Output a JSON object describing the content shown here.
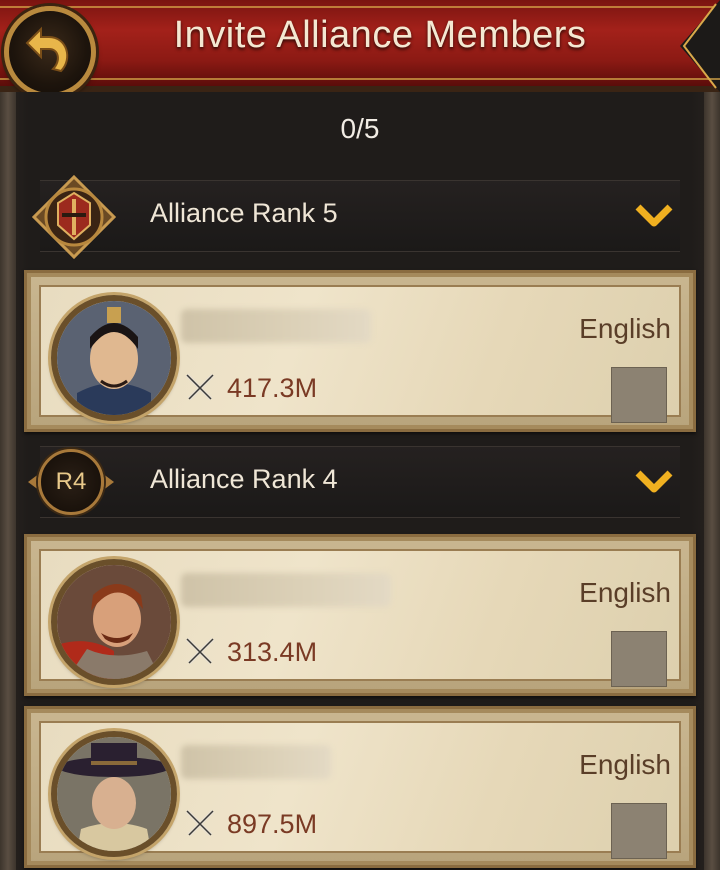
{
  "header": {
    "title": "Invite Alliance Members",
    "back_icon": "curved-back-arrow-icon"
  },
  "selection": {
    "count_text": "0/5"
  },
  "groups": [
    {
      "rank_label": "Alliance Rank 5",
      "badge": "helmet-emblem-icon",
      "members": [
        {
          "name": "",
          "power": "417.3M",
          "language": "English",
          "selected": false
        }
      ]
    },
    {
      "rank_label": "Alliance Rank 4",
      "badge_text": "R4",
      "members": [
        {
          "name": "",
          "power": "313.4M",
          "language": "English",
          "selected": false
        },
        {
          "name": "",
          "power": "897.5M",
          "language": "English",
          "selected": false
        }
      ]
    }
  ],
  "colors": {
    "banner_red": "#a3211a",
    "gold": "#d9a94a",
    "power_text": "#7a3a24",
    "card_parchment": "#e8dcc0"
  }
}
